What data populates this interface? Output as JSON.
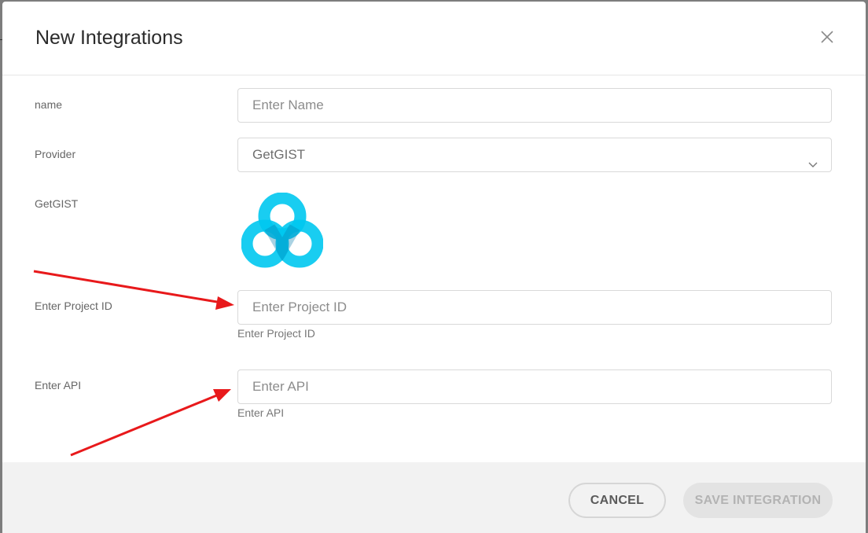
{
  "modal": {
    "title": "New Integrations"
  },
  "form": {
    "name": {
      "label": "name",
      "placeholder": "Enter Name",
      "value": ""
    },
    "provider": {
      "label": "Provider",
      "selected": "GetGIST"
    },
    "logo": {
      "label": "GetGIST",
      "icon": "getgist-logo",
      "color": "#00c8f0"
    },
    "project_id": {
      "label": "Enter Project ID",
      "placeholder": "Enter Project ID",
      "value": "",
      "hint": "Enter Project ID"
    },
    "api": {
      "label": "Enter API",
      "placeholder": "Enter API",
      "value": "",
      "hint": "Enter API"
    }
  },
  "footer": {
    "cancel_label": "CANCEL",
    "save_label": "SAVE INTEGRATION",
    "save_enabled": false
  },
  "annotations": {
    "arrow_color": "#e8191b"
  }
}
